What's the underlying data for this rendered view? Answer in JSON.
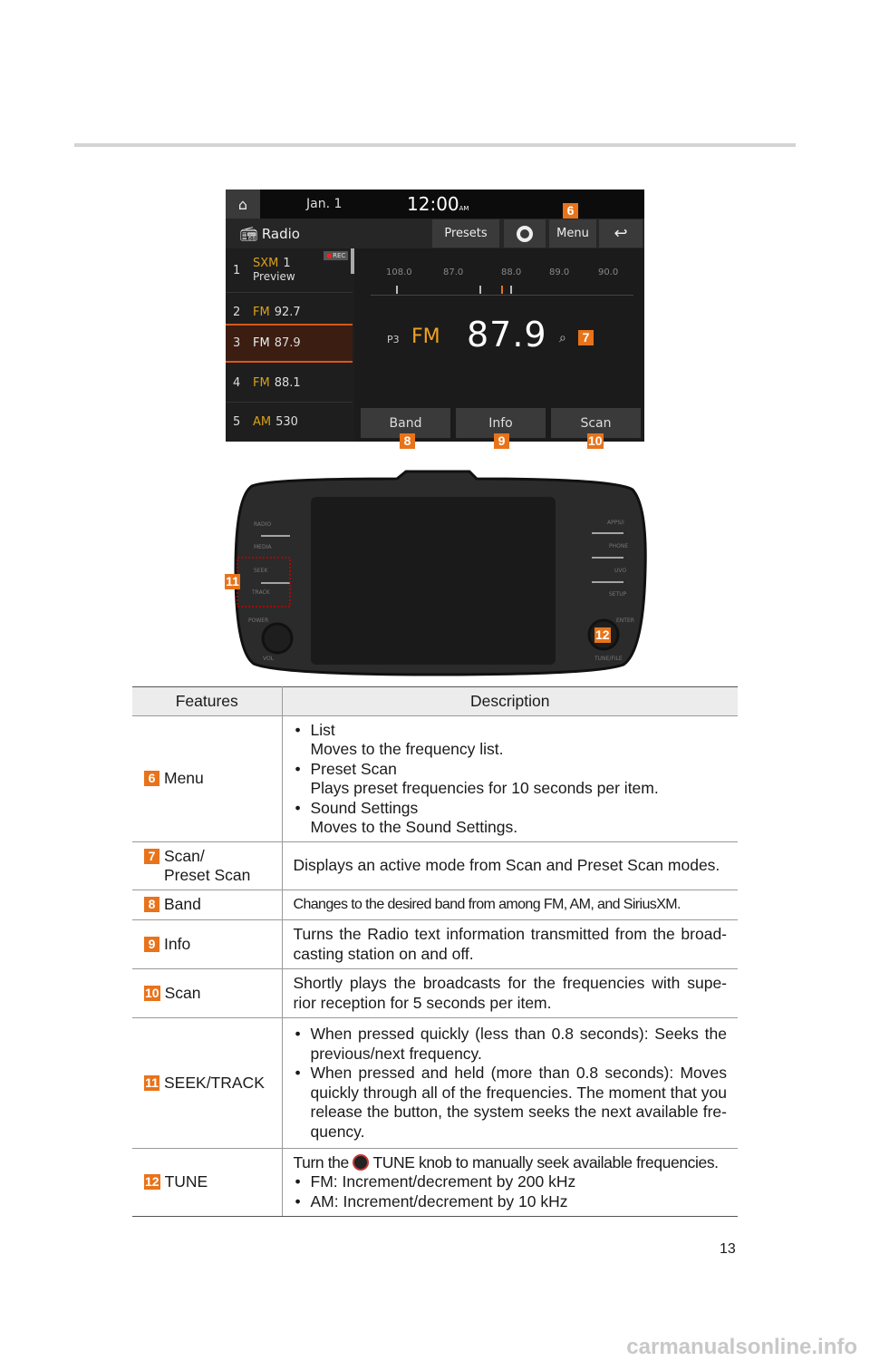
{
  "screen": {
    "date": "Jan. 1",
    "time": "12:00",
    "ampm": "AM",
    "title": "Radio",
    "buttons": {
      "presets": "Presets",
      "menu": "Menu"
    },
    "rec": "REC",
    "list": [
      {
        "num": "1",
        "band": "SXM",
        "value": "1",
        "sub": "Preview"
      },
      {
        "num": "2",
        "band": "FM",
        "value": "92.7"
      },
      {
        "num": "3",
        "band": "FM",
        "value": "87.9"
      },
      {
        "num": "4",
        "band": "FM",
        "value": "88.1"
      },
      {
        "num": "5",
        "band": "AM",
        "value": "530"
      }
    ],
    "dial": [
      "108.0",
      "87.0",
      "88.0",
      "89.0",
      "90.0"
    ],
    "preset": "P3",
    "band": "FM",
    "frequency": "87.9",
    "bottom": [
      "Band",
      "Info",
      "Scan"
    ]
  },
  "callouts": [
    "6",
    "7",
    "8",
    "9",
    "10",
    "11",
    "12"
  ],
  "unit": {
    "left": [
      "RADIO",
      "MEDIA",
      "SEEK",
      "TRACK"
    ],
    "right": [
      "APPS/i",
      "PHONE",
      "UVO",
      "SETUP"
    ],
    "power": "POWER",
    "vol": "VOL",
    "enter": "ENTER",
    "tune": "TUNE/FILE"
  },
  "table": {
    "headers": [
      "Features",
      "Description"
    ],
    "rows": [
      {
        "badge": "6",
        "feature": "Menu",
        "items": [
          {
            "t": "List",
            "d": "Moves to the frequency list."
          },
          {
            "t": "Preset Scan",
            "d": "Plays preset frequencies for 10 seconds per item."
          },
          {
            "t": "Sound Settings",
            "d": "Moves to the Sound Settings."
          }
        ]
      },
      {
        "badge": "7",
        "feature": "Scan/ Preset Scan",
        "text": "Displays an active mode from Scan and Preset Scan modes."
      },
      {
        "badge": "8",
        "feature": "Band",
        "text": "Changes to the desired band from among FM, AM, and SiriusXM."
      },
      {
        "badge": "9",
        "feature": "Info",
        "text": "Turns the Radio text information transmitted from the broad-casting station on and off."
      },
      {
        "badge": "10",
        "feature": "Scan",
        "text": "Shortly plays the broadcasts for the frequencies with supe-rior reception for 5 seconds per item."
      },
      {
        "badge": "11",
        "feature": "SEEK/TRACK",
        "items": [
          {
            "t": "When pressed quickly (less than 0.8 seconds): Seeks the previous/next frequency."
          },
          {
            "t": "When pressed and held (more than 0.8 seconds): Moves quickly through all of the frequencies. The moment that you release the button, the system seeks the next available fre-quency."
          }
        ]
      },
      {
        "badge": "12",
        "feature": "TUNE",
        "pre": "Turn the",
        "knob": "TUNE",
        "post": "knob to manually seek available frequencies.",
        "items": [
          {
            "t": "FM: Increment/decrement by 200 kHz"
          },
          {
            "t": "AM: Increment/decrement by 10 kHz"
          }
        ]
      }
    ]
  },
  "page_number": "13",
  "watermark": "carmanualsonline.info",
  "colors": {
    "badge": "#e8731a",
    "band_text": "#d9a11a",
    "selected_row": "#3b1d12"
  }
}
